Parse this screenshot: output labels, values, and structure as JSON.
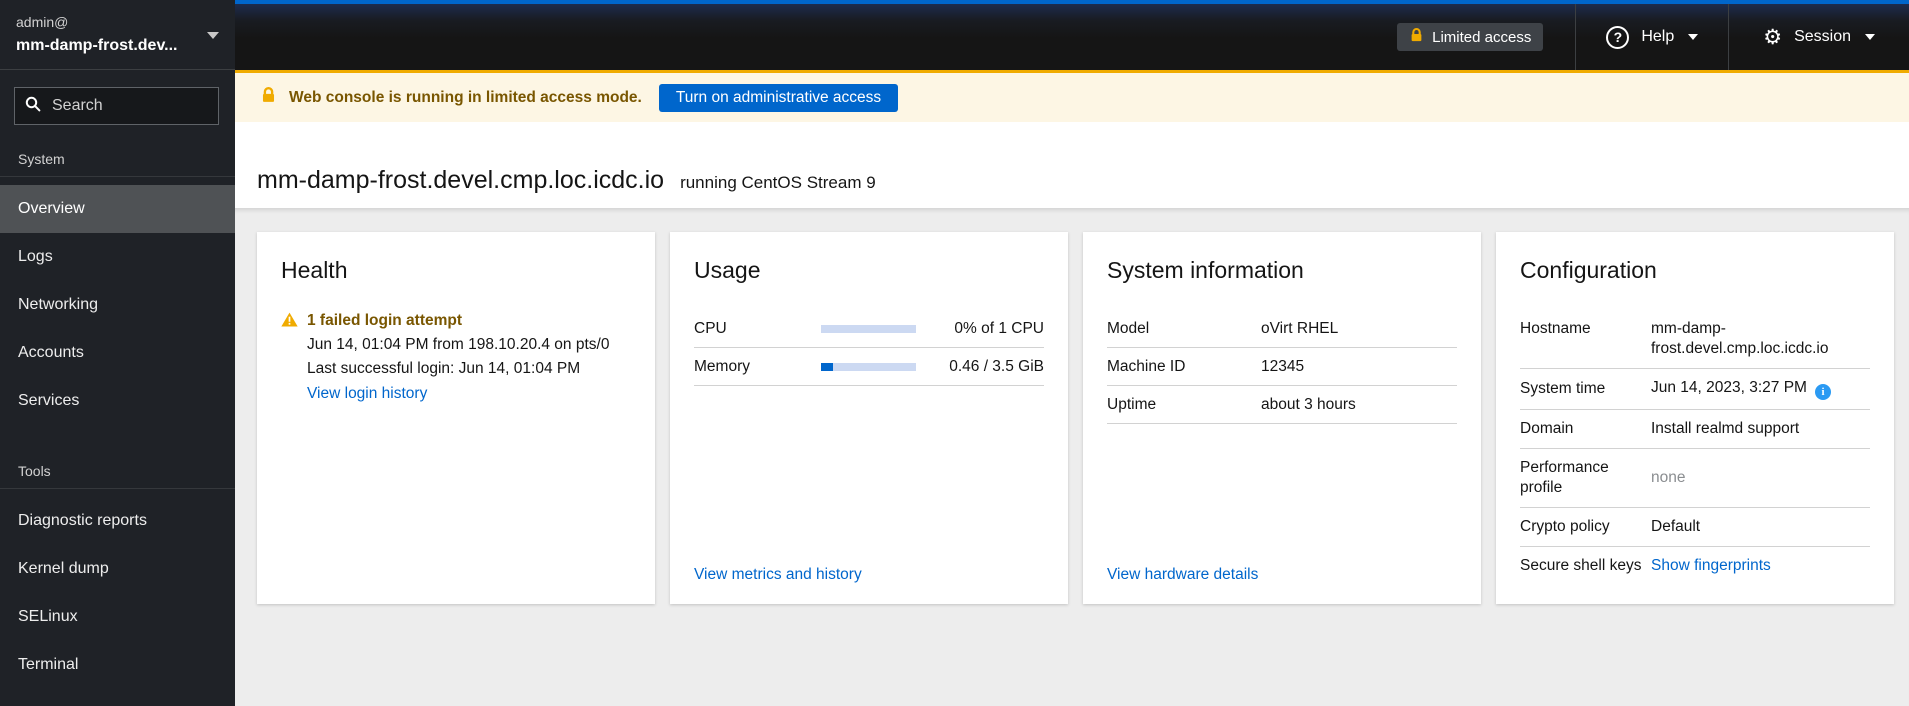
{
  "masthead": {
    "limited_access_label": "Limited access",
    "help_label": "Help",
    "session_label": "Session"
  },
  "brand": {
    "user": "admin@",
    "host": "mm-damp-frost.dev..."
  },
  "sidebar": {
    "search_placeholder": "Search",
    "sections": [
      {
        "label": "System",
        "items": [
          {
            "label": "Overview",
            "active": true
          },
          {
            "label": "Logs"
          },
          {
            "label": "Networking"
          },
          {
            "label": "Accounts"
          },
          {
            "label": "Services"
          }
        ]
      },
      {
        "label": "Tools",
        "items": [
          {
            "label": "Diagnostic reports"
          },
          {
            "label": "Kernel dump"
          },
          {
            "label": "SELinux"
          },
          {
            "label": "Terminal"
          }
        ]
      }
    ]
  },
  "banner": {
    "message": "Web console is running in limited access mode.",
    "button_label": "Turn on administrative access"
  },
  "page_header": {
    "hostname": "mm-damp-frost.devel.cmp.loc.icdc.io",
    "subtitle": "running CentOS Stream 9"
  },
  "cards": {
    "health": {
      "title": "Health",
      "alert_title": "1 failed login attempt",
      "alert_detail": "Jun 14, 01:04 PM from 198.10.20.4 on pts/0",
      "alert_last_login": "Last successful login: Jun 14, 01:04 PM",
      "link": "View login history"
    },
    "usage": {
      "title": "Usage",
      "rows": [
        {
          "label": "CPU",
          "value": "0% of 1 CPU",
          "percent": 0
        },
        {
          "label": "Memory",
          "value": "0.46 / 3.5 GiB",
          "percent": 13
        }
      ],
      "link": "View metrics and history"
    },
    "system_information": {
      "title": "System information",
      "rows": [
        {
          "label": "Model",
          "value": "oVirt RHEL"
        },
        {
          "label": "Machine ID",
          "value": "12345"
        },
        {
          "label": "Uptime",
          "value": "about 3 hours"
        }
      ],
      "link": "View hardware details"
    },
    "configuration": {
      "title": "Configuration",
      "rows": [
        {
          "label": "Hostname",
          "value": "mm-damp-frost.devel.cmp.loc.icdc.io",
          "label_align_top": true
        },
        {
          "label": "System time",
          "value": "Jun 14, 2023, 3:27 PM",
          "info": true
        },
        {
          "label": "Domain",
          "value": "Install realmd support"
        },
        {
          "label": "Performance profile",
          "value": "none",
          "muted": true
        },
        {
          "label": "Crypto policy",
          "value": "Default"
        },
        {
          "label": "Secure shell keys",
          "value": "Show fingerprints",
          "link": true
        }
      ]
    }
  },
  "colors": {
    "accent_blue": "#0066cc",
    "link_blue": "#0066cc",
    "warning_gold": "#f0ab00",
    "warning_text": "#795600",
    "masthead_bg": "#151515",
    "sidebar_bg": "#1f2227",
    "selected_nav_bg": "#4f5255",
    "banner_bg": "#fdf6e4",
    "content_bg": "#ededed",
    "progress_track": "#ccd9f2",
    "info_icon_blue": "#2b9af3"
  }
}
